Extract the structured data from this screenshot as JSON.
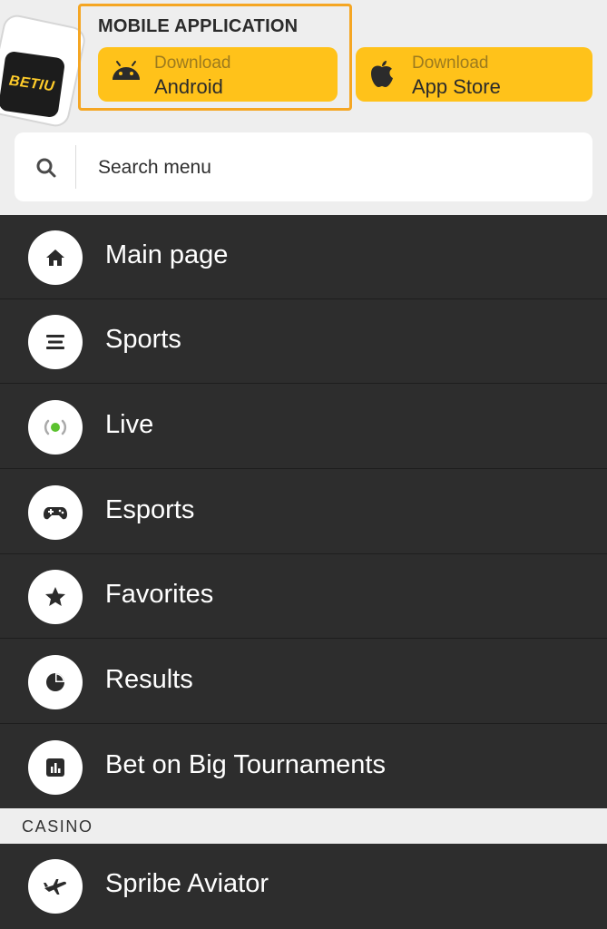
{
  "app": {
    "logo_text": "BETIU",
    "mobile_title": "MOBILE APPLICATION",
    "android": {
      "small": "Download",
      "big": "Android"
    },
    "ios": {
      "small": "Download",
      "big": "App Store"
    },
    "accent_color": "#ffc21a",
    "highlight_color": "#f5a623"
  },
  "search": {
    "placeholder": "Search menu"
  },
  "menu": {
    "items": [
      {
        "label": "Main page",
        "icon": "home-icon"
      },
      {
        "label": "Sports",
        "icon": "list-icon"
      },
      {
        "label": "Live",
        "icon": "live-icon"
      },
      {
        "label": "Esports",
        "icon": "gamepad-icon"
      },
      {
        "label": "Favorites",
        "icon": "star-icon"
      },
      {
        "label": "Results",
        "icon": "pie-chart-icon"
      },
      {
        "label": "Bet on Big Tournaments",
        "icon": "bar-chart-icon"
      }
    ]
  },
  "casino": {
    "section_label": "CASINO",
    "items": [
      {
        "label": "Spribe Aviator",
        "icon": "plane-icon"
      }
    ]
  }
}
